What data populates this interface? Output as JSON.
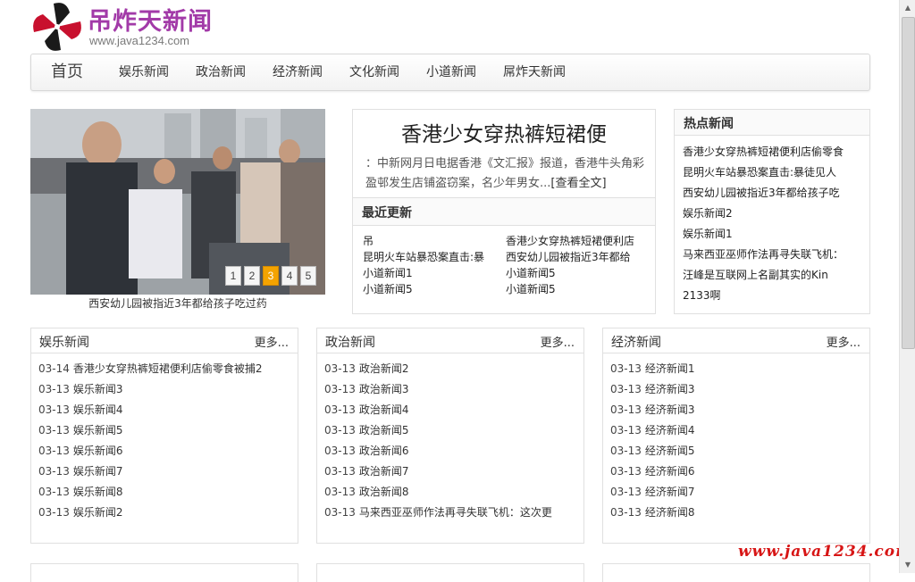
{
  "logo": {
    "title": "吊炸天新闻",
    "url": "www.java1234.com",
    "icon": "pinwheel-logo-icon"
  },
  "nav": {
    "items": [
      "首页",
      "娱乐新闻",
      "政治新闻",
      "经济新闻",
      "文化新闻",
      "小道新闻",
      "屌炸天新闻"
    ]
  },
  "slider": {
    "pages": [
      "1",
      "2",
      "3",
      "4",
      "5"
    ],
    "active_page": 3,
    "caption": "西安幼儿园被指近3年都给孩子吃过药"
  },
  "headline": {
    "title": "香港少女穿热裤短裙便",
    "summary": "：中新网月日电据香港《文汇报》报道，香港牛头角彩盈邨发生店铺盗窃案，名少年男女...",
    "read_more": "[查看全文]"
  },
  "latest": {
    "title": "最近更新",
    "items": [
      "吊",
      "香港少女穿热裤短裙便利店",
      "昆明火车站暴恐案直击:暴",
      "西安幼儿园被指近3年都给",
      "小道新闻1",
      "小道新闻5",
      "小道新闻5",
      "小道新闻5"
    ]
  },
  "hot": {
    "title": "热点新闻",
    "lines": [
      "香港少女穿热裤短裙便利店偷零食",
      "昆明火车站暴恐案直击:暴徒见人",
      "西安幼儿园被指近3年都给孩子吃",
      "娱乐新闻2",
      "娱乐新闻1",
      "马来西亚巫师作法再寻失联飞机：",
      "汪峰是互联网上名副其实的Kin",
      "2133啊"
    ]
  },
  "categories": [
    {
      "title": "娱乐新闻",
      "more": "更多...",
      "rows": [
        {
          "date": "03-14",
          "text": "香港少女穿热裤短裙便利店偷零食被捕2"
        },
        {
          "date": "03-13",
          "text": "娱乐新闻3"
        },
        {
          "date": "03-13",
          "text": "娱乐新闻4"
        },
        {
          "date": "03-13",
          "text": "娱乐新闻5"
        },
        {
          "date": "03-13",
          "text": "娱乐新闻6"
        },
        {
          "date": "03-13",
          "text": "娱乐新闻7"
        },
        {
          "date": "03-13",
          "text": "娱乐新闻8"
        },
        {
          "date": "03-13",
          "text": "娱乐新闻2"
        }
      ]
    },
    {
      "title": "政治新闻",
      "more": "更多...",
      "rows": [
        {
          "date": "03-13",
          "text": "政治新闻2"
        },
        {
          "date": "03-13",
          "text": "政治新闻3"
        },
        {
          "date": "03-13",
          "text": "政治新闻4"
        },
        {
          "date": "03-13",
          "text": "政治新闻5"
        },
        {
          "date": "03-13",
          "text": "政治新闻6"
        },
        {
          "date": "03-13",
          "text": "政治新闻7"
        },
        {
          "date": "03-13",
          "text": "政治新闻8"
        },
        {
          "date": "03-13",
          "text": "马来西亚巫师作法再寻失联飞机：这次更"
        }
      ]
    },
    {
      "title": "经济新闻",
      "more": "更多...",
      "rows": [
        {
          "date": "03-13",
          "text": "经济新闻1"
        },
        {
          "date": "03-13",
          "text": "经济新闻3"
        },
        {
          "date": "03-13",
          "text": "经济新闻3"
        },
        {
          "date": "03-13",
          "text": "经济新闻4"
        },
        {
          "date": "03-13",
          "text": "经济新闻5"
        },
        {
          "date": "03-13",
          "text": "经济新闻6"
        },
        {
          "date": "03-13",
          "text": "经济新闻7"
        },
        {
          "date": "03-13",
          "text": "经济新闻8"
        }
      ]
    }
  ],
  "watermark": "www.java1234.com"
}
